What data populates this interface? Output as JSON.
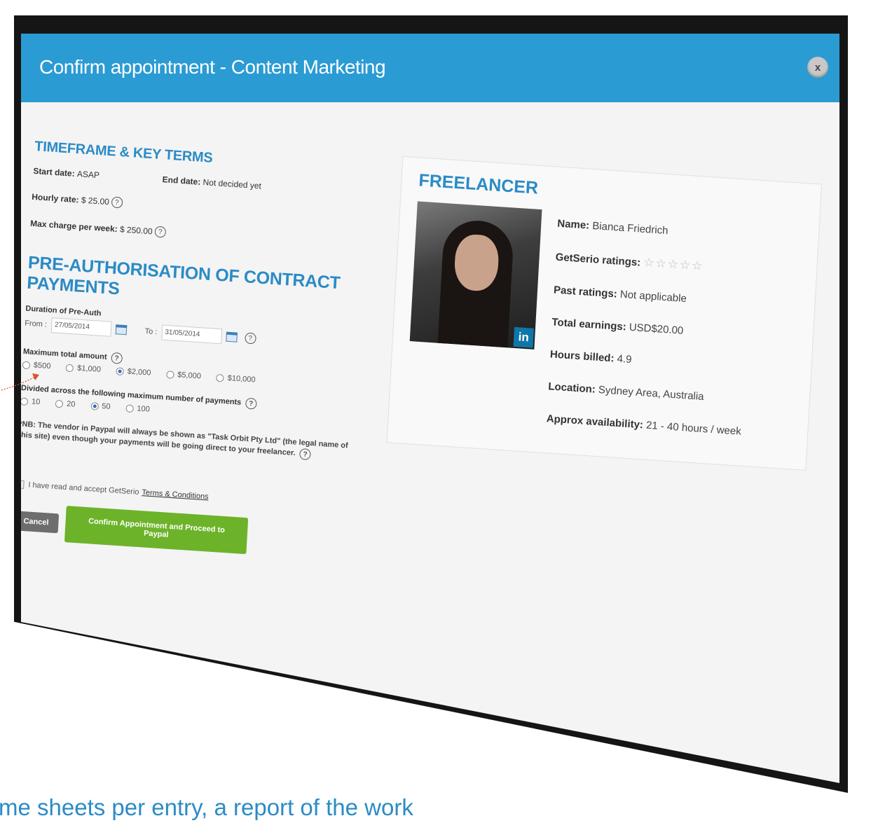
{
  "modal": {
    "title": "Confirm appointment - Content Marketing",
    "close_label": "x"
  },
  "timeframe": {
    "title": "TIMEFRAME & KEY TERMS",
    "start_label": "Start date:",
    "start_value": "ASAP",
    "end_label": "End date:",
    "end_value": "Not decided yet",
    "hourly_label": "Hourly rate:",
    "hourly_value": "$ 25.00",
    "max_week_label": "Max charge per week:",
    "max_week_value": "$ 250.00"
  },
  "preauth": {
    "title": "PRE-AUTHORISATION OF CONTRACT PAYMENTS",
    "duration_label": "Duration of Pre-Auth",
    "from_label": "From :",
    "from_value": "27/05/2014",
    "to_label": "To :",
    "to_value": "31/05/2014",
    "max_total_label": "Maximum total amount",
    "amount_options": [
      "$500",
      "$1,000",
      "$2,000",
      "$5,000",
      "$10,000"
    ],
    "amount_selected_index": 2,
    "payments_label": "Divided across the following maximum number of payments",
    "payment_options": [
      "10",
      "20",
      "50",
      "100"
    ],
    "payment_selected_index": 2,
    "note": "*NB: The vendor in Paypal will always be shown as \"Task Orbit Pty Ltd\" (the legal name of this site) even though your payments will be going direct to your freelancer."
  },
  "footer": {
    "accept_text": "I have read and accept GetSerio",
    "terms_link": "Terms & Conditions",
    "cancel_label": "Cancel",
    "confirm_label": "Confirm Appointment and Proceed to Paypal"
  },
  "freelancer": {
    "title": "FREELANCER",
    "linkedin_label": "in",
    "name_label": "Name:",
    "name_value": "Bianca Friedrich",
    "ratings_label": "GetSerio ratings:",
    "ratings_value": 0,
    "ratings_max": 5,
    "past_label": "Past ratings:",
    "past_value": "Not applicable",
    "earnings_label": "Total earnings:",
    "earnings_value": "USD$20.00",
    "hours_label": "Hours billed:",
    "hours_value": "4.9",
    "location_label": "Location:",
    "location_value": "Sydney Area, Australia",
    "availability_label": "Approx availability:",
    "availability_value": "21 - 40 hours / week"
  },
  "caption": {
    "text": "me sheets per entry, a report of the work"
  },
  "colors": {
    "header_blue": "#2b9bd3",
    "section_blue": "#2b8bc6",
    "confirm_green": "#6cb32a",
    "cancel_gray": "#6d6d6d"
  }
}
